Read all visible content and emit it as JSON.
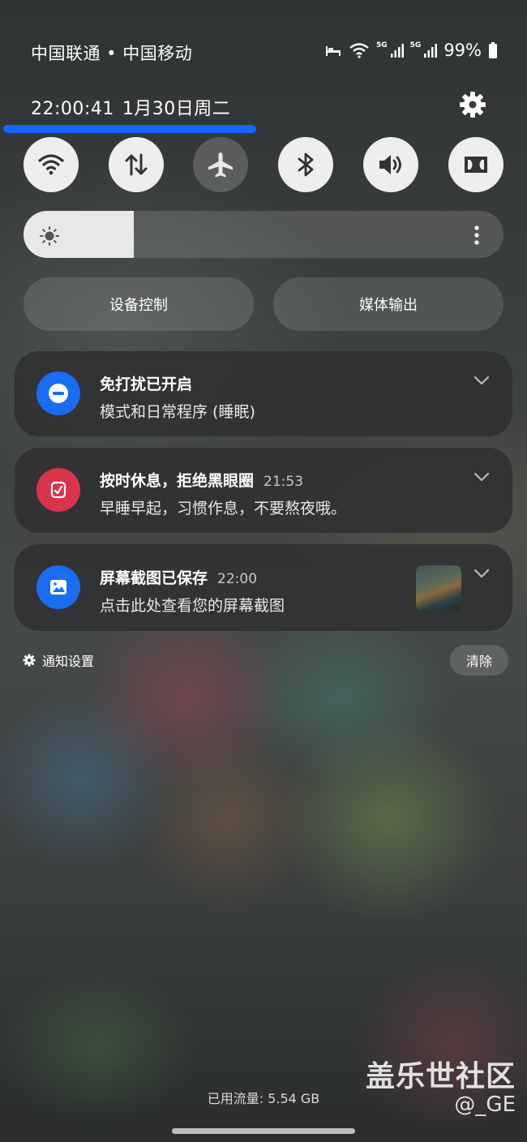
{
  "status_bar": {
    "carriers": "中国联通 • 中国移动",
    "signal_label_1": "5G",
    "signal_label_2": "5G",
    "battery": "99%",
    "icons": [
      "sleep-mode-icon",
      "wifi-icon",
      "signal-icon",
      "signal-icon",
      "battery-icon"
    ]
  },
  "header": {
    "time": "22:00:41",
    "date": "1月30日周二"
  },
  "quick_toggles": [
    {
      "name": "wifi",
      "icon": "wifi-icon",
      "on": true
    },
    {
      "name": "mobile-data",
      "icon": "data-arrows-icon",
      "on": true
    },
    {
      "name": "airplane-mode",
      "icon": "airplane-icon",
      "on": false
    },
    {
      "name": "bluetooth",
      "icon": "bluetooth-icon",
      "on": true
    },
    {
      "name": "sound",
      "icon": "volume-icon",
      "on": true
    },
    {
      "name": "dolby-atmos",
      "icon": "dolby-icon",
      "on": true
    }
  ],
  "brightness": {
    "level": 0.23
  },
  "controls": {
    "device_control": "设备控制",
    "media_output": "媒体输出"
  },
  "notifications": [
    {
      "title": "免打扰已开启",
      "time": "",
      "text": "模式和日常程序 (睡眠)",
      "icon": "do-not-disturb-icon",
      "icon_color": "#1a6cf0"
    },
    {
      "title": "按时休息，拒绝黑眼圈",
      "time": "21:53",
      "text": "早睡早起，习惯作息，不要熬夜哦。",
      "icon": "sleep-app-icon",
      "icon_color": "#d8344a"
    },
    {
      "title": "屏幕截图已保存",
      "time": "22:00",
      "text": "点击此处查看您的屏幕截图",
      "icon": "image-icon",
      "icon_color": "#1a6cf0"
    }
  ],
  "footer": {
    "notification_settings": "通知设置",
    "clear": "清除",
    "data_usage": "已用流量: 5.54 GB"
  },
  "watermark": {
    "line1": "盖乐世社区",
    "line2": "@_GE"
  }
}
